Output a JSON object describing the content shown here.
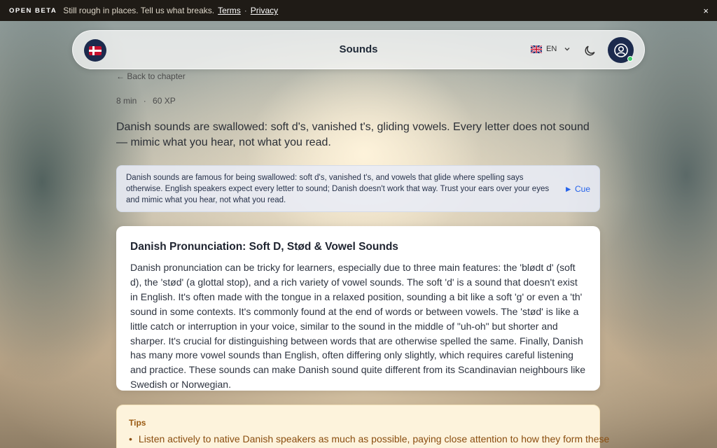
{
  "banner": {
    "tag": "OPEN BETA",
    "message": "Still rough in places. Tell us what breaks.",
    "terms_link": "Terms",
    "separator": "·",
    "privacy_link": "Privacy",
    "close": "×"
  },
  "nav": {
    "title": "Sounds",
    "lang_code": "EN",
    "icons": [
      "danish-flag-logo-icon",
      "uk-flag-icon",
      "chevron-down-icon",
      "moon-icon",
      "user-avatar-icon"
    ]
  },
  "page": {
    "back_link": "← Back to chapter",
    "duration": "8 min",
    "meta_sep": "·",
    "xp": "60 XP",
    "intro": "Danish sounds are swallowed: soft d's, vanished t's, gliding vowels. Every letter does not sound — mimic what you hear, not what you read."
  },
  "summary": {
    "text": "Danish sounds are famous for being swallowed: soft d's, vanished t's, and vowels that glide where spelling says otherwise. English speakers expect every letter to sound; Danish doesn't work that way. Trust your ears over your eyes and mimic what you hear, not what you read.",
    "cue": "► Cue"
  },
  "card": {
    "title": "Danish Pronunciation: Soft D, Stød & Vowel Sounds",
    "body": "Danish pronunciation can be tricky for learners, especially due to three main features: the 'blødt d' (soft d), the 'stød' (a glottal stop), and a rich variety of vowel sounds. The soft 'd' is a sound that doesn't exist in English. It's often made with the tongue in a relaxed position, sounding a bit like a soft 'g' or even a 'th' sound in some contexts. It's commonly found at the end of words or between vowels. The 'stød' is like a little catch or interruption in your voice, similar to the sound in the middle of \"uh-oh\" but shorter and sharper. It's crucial for distinguishing between words that are otherwise spelled the same. Finally, Danish has many more vowel sounds than English, often differing only slightly, which requires careful listening and practice. These sounds can make Danish sound quite different from its Scandinavian neighbours like Swedish or Norwegian."
  },
  "tips": {
    "heading": "Tips",
    "items": [
      "Listen actively to native Danish speakers as much as possible, paying close attention to how they form these"
    ]
  },
  "colors": {
    "banner_bg": "#1f1b16",
    "accent_link": "#2563eb",
    "tips_text": "#8a4d0f",
    "brand_navy": "#1c2a4d"
  }
}
